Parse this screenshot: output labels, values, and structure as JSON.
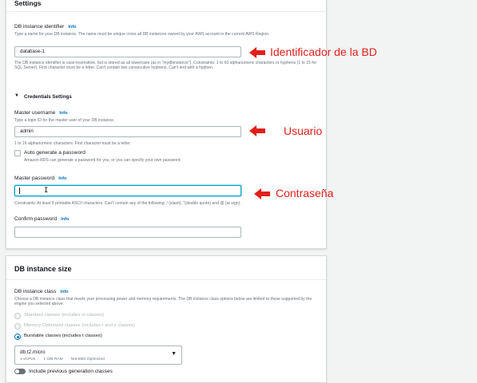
{
  "settings": {
    "title": "Settings",
    "db_identifier": {
      "label": "DB instance identifier",
      "info": "Info",
      "help": "Type a name for your DB instance. The name must be unique cross all DB instances owned by your AWS account in the current AWS Region.",
      "value": "database-1",
      "constraints": "The DB instance identifier is case-insensitive, but is stored as all lowercase (as in \"mydbinstance\"). Constraints: 1 to 60 alphanumeric characters or hyphens (1 to 15 for SQL Server). First character must be a letter. Can't contain two consecutive hyphens. Can't end with a hyphen."
    },
    "credentials": {
      "title": "Credentials Settings",
      "username": {
        "label": "Master username",
        "info": "Info",
        "help": "Type a login ID for the master user of your DB instance.",
        "value": "admin",
        "constraints": "1 to 16 alphanumeric characters. First character must be a letter"
      },
      "auto_password": {
        "label": "Auto generate a password",
        "help": "Amazon RDS can generate a password for you, or you can specify your own password"
      },
      "password": {
        "label": "Master password",
        "info": "Info",
        "value": "",
        "constraints": "Constraints: At least 8 printable ASCII characters. Can't contain any of the following: / (slash), \"(double quote) and @ (at sign)."
      },
      "confirm": {
        "label": "Confirm password",
        "info": "Info",
        "value": ""
      }
    }
  },
  "size": {
    "title": "DB instance size",
    "class_label": "DB instance class",
    "info": "Info",
    "help": "Choose a DB instance class that meets your processing power and memory requirements. The DB instance class options below are limited to those supported by the engine you selected above.",
    "options": [
      "Standard classes (includes m classes)",
      "Memory Optimized classes (includes r and x classes)",
      "Burstable classes (includes t classes)"
    ],
    "selected_option": 2,
    "select": {
      "value": "db.t2.micro",
      "sub": [
        "1 vCPUs",
        "1 GiB RAM",
        "Not EBS Optimized"
      ]
    },
    "prev_gen": "Include previous generation classes"
  },
  "annotations": {
    "identifier": "Identificador de la BD",
    "user": "Usuario",
    "password": "Contraseña"
  },
  "colors": {
    "annotation": "#e0201b",
    "link": "#0073bb",
    "focus": "#00a1c9"
  }
}
